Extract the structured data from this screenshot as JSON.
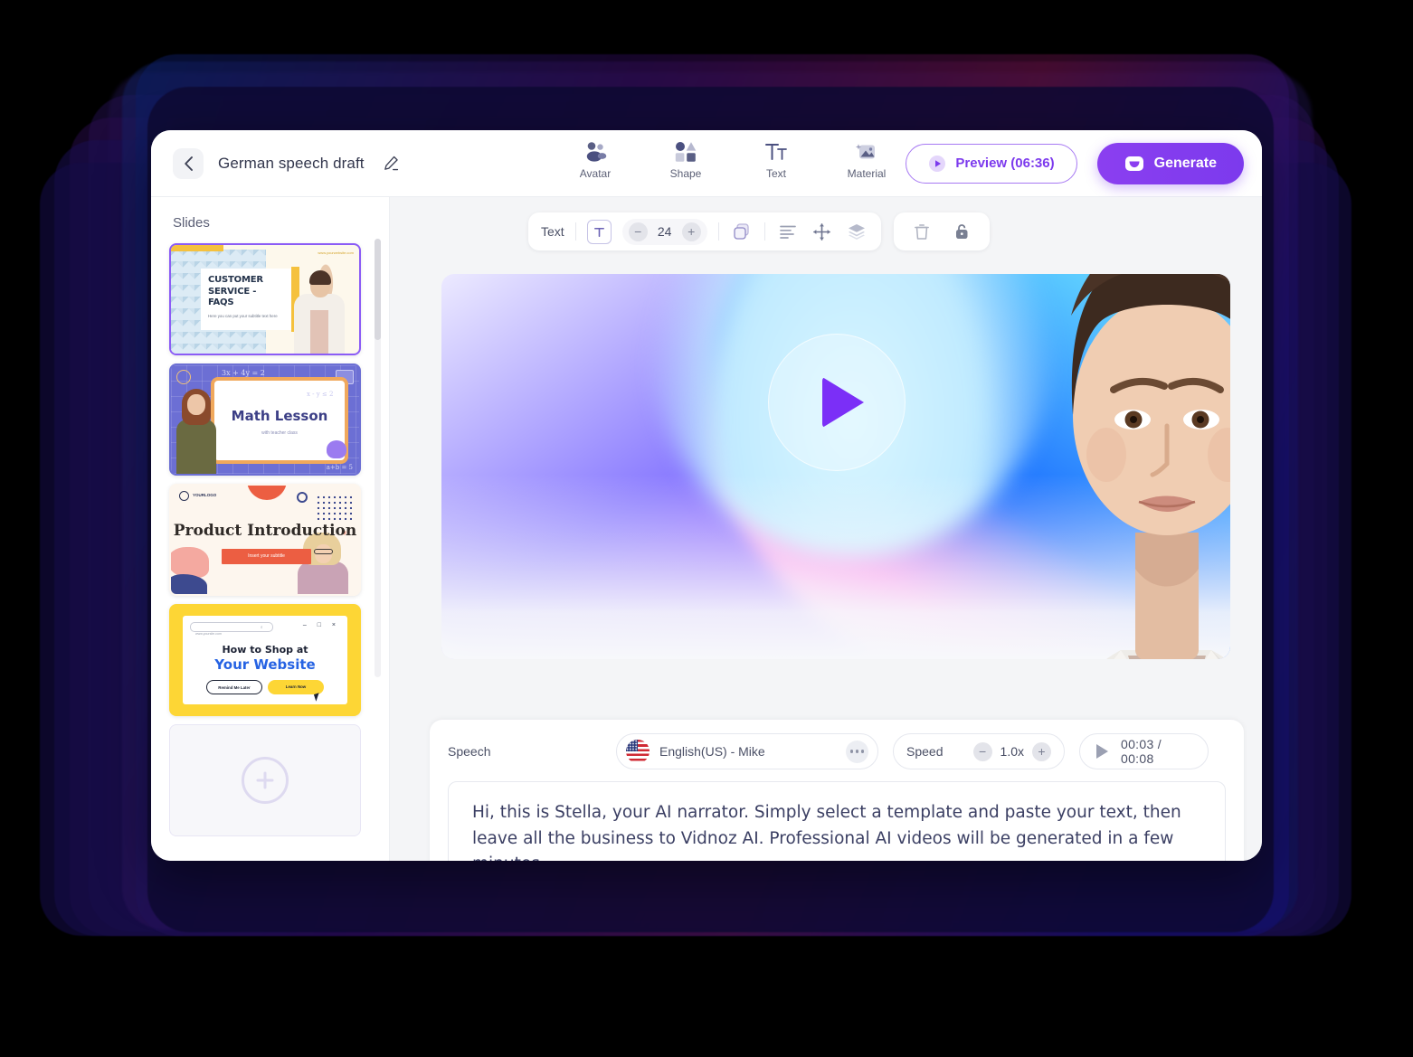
{
  "window": {
    "title": "German speech draft",
    "back_icon": "chevron-left-icon",
    "edit_icon": "pencil-icon",
    "more_arrow_icon": "arrow-right-icon"
  },
  "toolbar": {
    "items": [
      {
        "label": "Avatar",
        "icon": "avatar-people-icon"
      },
      {
        "label": "Shape",
        "icon": "shapes-icon"
      },
      {
        "label": "Text",
        "icon": "text-tt-icon"
      },
      {
        "label": "Material",
        "icon": "image-material-icon"
      }
    ],
    "preview_label": "Preview (06:36)",
    "preview_icon": "play-circle-icon",
    "generate_label": "Generate",
    "generate_icon": "sparkle-logo-icon"
  },
  "text_toolbar": {
    "type_label": "Text",
    "font_style_icon": "text-box-icon",
    "font_size": "24",
    "minus_icon": "minus-icon",
    "plus_icon": "plus-icon",
    "color_icon": "color-swatch-icon",
    "align_icon": "align-left-icon",
    "position_icon": "move-arrows-icon",
    "layer_icon": "layers-icon",
    "delete_icon": "trash-icon",
    "lock_icon": "lock-open-icon"
  },
  "slides": {
    "title": "Slides",
    "items": [
      {
        "name": "Customer Service - FAQs",
        "selected": true,
        "title_line1": "CUSTOMER",
        "title_line2": "SERVICE - FAQS",
        "subtitle": "Here you can put your subtitle text here",
        "url": "www.yourwebsite.com"
      },
      {
        "name": "Math Lesson",
        "selected": false,
        "title": "Math Lesson",
        "subtitle": "with teacher class",
        "eq1": "3x + 4y = 2",
        "eq2": "x - y ≤ 2",
        "eq3": "a+b = 5"
      },
      {
        "name": "Product Introduction",
        "selected": false,
        "title": "Product Introduction",
        "button": "Insert your subtitle",
        "logo": "YOURLOGO"
      },
      {
        "name": "How to Shop at Your Website",
        "selected": false,
        "address": "www.yoursite.com",
        "window_controls": "– □ ×",
        "title_line1": "How to Shop at",
        "title_line2": "Your Website",
        "button1": "Remind Me Later",
        "button2": "Learn Now"
      }
    ],
    "add_label": "add-slide",
    "add_icon": "plus-icon"
  },
  "video": {
    "play_icon": "play-triangle-icon"
  },
  "speech": {
    "label": "Speech",
    "voice": "English(US) - Mike",
    "voice_flag": "us-flag-icon",
    "more_icon": "ellipsis-icon",
    "speed_label": "Speed",
    "speed_value": "1.0x",
    "speed_minus_icon": "minus-icon",
    "speed_plus_icon": "plus-icon",
    "time_icon": "play-triangle-icon",
    "time": "00:03 / 00:08",
    "script": "Hi, this is Stella, your AI narrator. Simply select a template and paste your text, then leave all the business to Vidnoz AI. Professional AI videos will be generated in a few minutes."
  },
  "colors": {
    "accent_purple": "#7c3aed",
    "accent_light": "#a779f3",
    "slide_selected_border": "#8b5cf6",
    "panel_bg": "#f4f5f7",
    "text_dark": "#3b3f63",
    "background": "#000000"
  }
}
